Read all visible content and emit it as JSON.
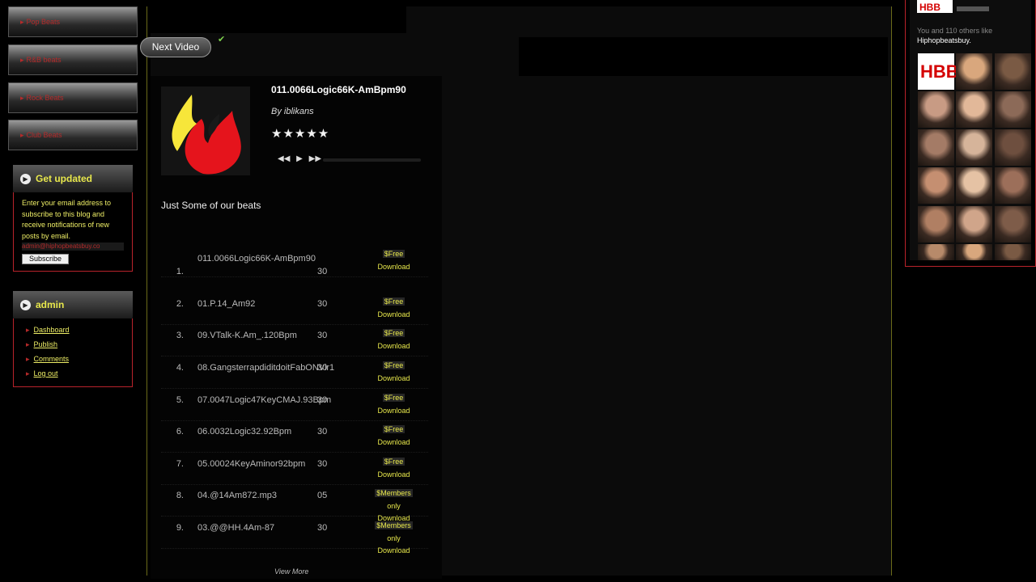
{
  "categories": [
    "Pop Beats",
    "R&B beats",
    "Rock Beats",
    "Club Beats"
  ],
  "get_updated": {
    "title": "Get updated",
    "text": "Enter your email address to subscribe to this blog and receive notifications of new posts by email.",
    "email_value": "admin@hiphopbeatsbuy.co",
    "subscribe_label": "Subscribe"
  },
  "admin": {
    "title": "admin",
    "links": [
      "Dashboard",
      "Publish",
      "Comments",
      "Log out"
    ]
  },
  "player": {
    "next_video": "Next Video",
    "track_title": "011.0066Logic66K-AmBpm90",
    "by": "By  iblikans",
    "stars": "★★★★★",
    "rating": 5,
    "section_title": "Just Some of our beats",
    "view_more": "View More"
  },
  "tracks": [
    {
      "num": "1.",
      "name": "011.0066Logic66K-AmBpm90",
      "count": "30",
      "dl": [
        "$Free",
        "Download"
      ]
    },
    {
      "num": "2.",
      "name": "01.P.14_Am92",
      "count": "30",
      "dl": [
        "$Free",
        "Download"
      ]
    },
    {
      "num": "3.",
      "name": "09.VTalk-K.Am_.120Bpm",
      "count": "30",
      "dl": [
        "$Free",
        "Download"
      ]
    },
    {
      "num": "4.",
      "name": "08.GangsterrapdiditdoitFabONVir1",
      "count": "30",
      "dl": [
        "$Free",
        "Download"
      ]
    },
    {
      "num": "5.",
      "name": "07.0047Logic47KeyCMAJ.93Bpm",
      "count": "30",
      "dl": [
        "$Free",
        "Download"
      ]
    },
    {
      "num": "6.",
      "name": "06.0032Logic32.92Bpm",
      "count": "30",
      "dl": [
        "$Free",
        "Download"
      ]
    },
    {
      "num": "7.",
      "name": "05.00024KeyAminor92bpm",
      "count": "30",
      "dl": [
        "$Free",
        "Download"
      ]
    },
    {
      "num": "8.",
      "name": "04.@14Am872.mp3",
      "count": "05",
      "dl": [
        "$Members",
        "only",
        "Download"
      ]
    },
    {
      "num": "9.",
      "name": "03.@@HH.4Am-87",
      "count": "30",
      "dl": [
        "$Members",
        "only",
        "Download"
      ]
    }
  ],
  "facebook": {
    "likes_text": "You and 110 others like",
    "page_name": "Hiphopbeatsbuy."
  },
  "colors": {
    "accent_yellow": "#e8e84c",
    "accent_red": "#b9232b",
    "background": "#000000"
  }
}
